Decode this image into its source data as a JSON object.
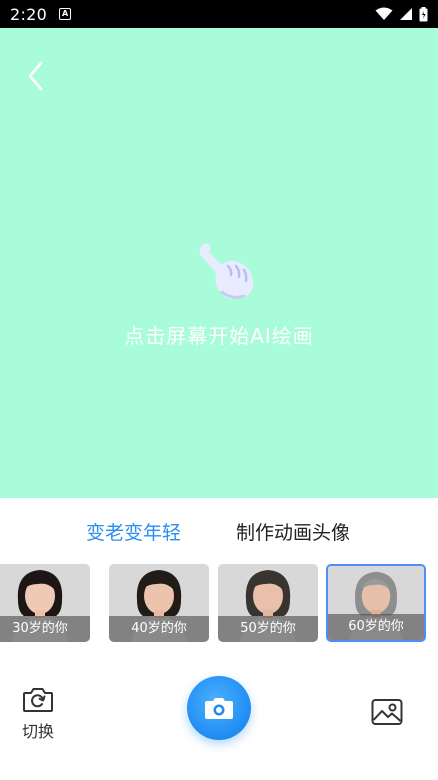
{
  "status_bar": {
    "time": "2:20",
    "notification_badge": "A",
    "icons": [
      "wifi-icon",
      "cellular-icon",
      "battery-icon"
    ]
  },
  "canvas": {
    "background_color": "#a8fcd9",
    "hint_text": "点击屏幕开始AI绘画",
    "icons": [
      "back-arrow-icon",
      "tap-hand-icon"
    ]
  },
  "tabs": [
    {
      "label": "变老变年轻",
      "active": true,
      "color": "#2a8ff0"
    },
    {
      "label": "制作动画头像",
      "active": false,
      "color": "#222222"
    }
  ],
  "age_options": [
    {
      "label": "30岁的你",
      "selected": false
    },
    {
      "label": "40岁的你",
      "selected": false
    },
    {
      "label": "50岁的你",
      "selected": false
    },
    {
      "label": "60岁的你",
      "selected": true
    }
  ],
  "bottom_bar": {
    "switch_label": "切换",
    "icons": [
      "camera-switch-icon",
      "camera-icon",
      "gallery-icon"
    ],
    "accent_color": "#1f8cf2"
  }
}
